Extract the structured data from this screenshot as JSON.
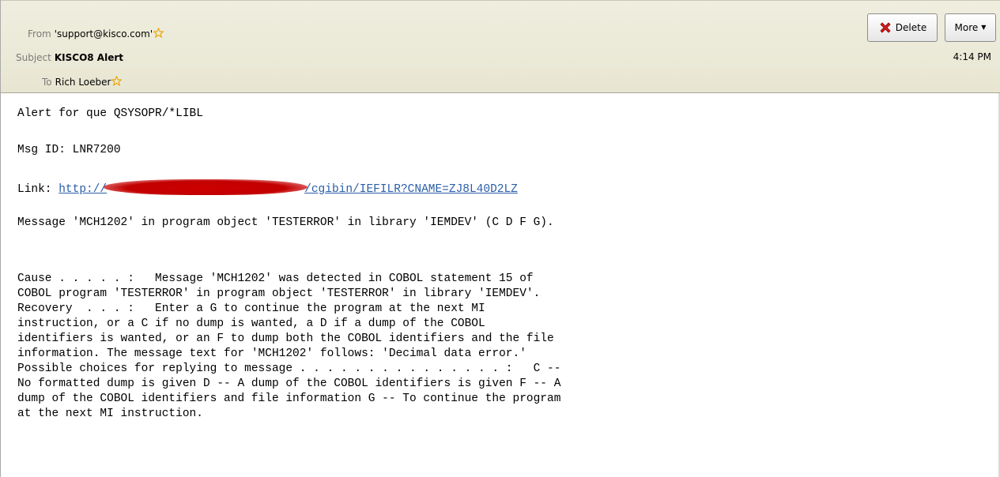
{
  "header": {
    "from_label": "From",
    "from_value": "'support@kisco.com'",
    "subject_label": "Subject",
    "subject_value": "KISCO8 Alert",
    "to_label": "To",
    "to_value": "Rich Loeber",
    "time": "4:14 PM",
    "delete_label": "Delete",
    "more_label": "More",
    "star_icon": "star-icon",
    "delete_icon": "red-x-icon"
  },
  "message": {
    "line1": "Alert for que QSYSOPR/*LIBL",
    "line2": "Msg ID: LNR7200",
    "link_label": "Link: ",
    "link_start": "http://",
    "link_end": "/cgibin/IEFILR?CNAME=ZJ8L40D2LZ",
    "line4": "Message 'MCH1202' in program object 'TESTERROR' in library 'IEMDEV' (C D F G).",
    "cause": [
      "Cause . . . . . :   Message 'MCH1202' was detected in COBOL statement 15 of",
      "COBOL program 'TESTERROR' in program object 'TESTERROR' in library 'IEMDEV'.",
      "Recovery  . . . :   Enter a G to continue the program at the next MI",
      "instruction, or a C if no dump is wanted, a D if a dump of the COBOL",
      "identifiers is wanted, or an F to dump both the COBOL identifiers and the file",
      "information. The message text for 'MCH1202' follows: 'Decimal data error.'",
      "Possible choices for replying to message . . . . . . . . . . . . . . . :   C --",
      "No formatted dump is given D -- A dump of the COBOL identifiers is given F -- A",
      "dump of the COBOL identifiers and file information G -- To continue the program",
      "at the next MI instruction."
    ]
  }
}
